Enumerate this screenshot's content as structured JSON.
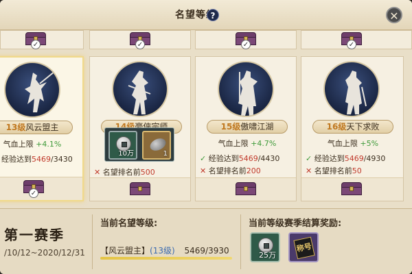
{
  "header": {
    "title": "名望等级",
    "help_icon": "?",
    "close_icon": "✕"
  },
  "cards": [
    {
      "level": "13级",
      "name": "风云盟主",
      "stat_label": "气血上限",
      "stat_bonus": "+4.1%",
      "exp_prefix": "经验达到",
      "exp_current": "5469",
      "exp_required": "/3430"
    },
    {
      "level": "14级",
      "name": "豪侠宗师",
      "stat_label": "",
      "stat_bonus": "",
      "exp_prefix": "",
      "exp_current": "",
      "exp_required": "",
      "rank_prefix": "名望排名前",
      "rank_value": "500"
    },
    {
      "level": "15级",
      "name": "傲啸江湖",
      "stat_label": "气血上限",
      "stat_bonus": "+4.7%",
      "exp_prefix": "经验达到",
      "exp_current": "5469",
      "exp_required": "/4430",
      "rank_prefix": "名望排名前",
      "rank_value": "200"
    },
    {
      "level": "16级",
      "name": "天下求败",
      "stat_label": "气血上限",
      "stat_bonus": "+5%",
      "exp_prefix": "经验达到",
      "exp_current": "5469",
      "exp_required": "/4930",
      "rank_prefix": "名望排名前",
      "rank_value": "50"
    }
  ],
  "popup": {
    "item1_amount": "10万",
    "item2_amount": "1"
  },
  "season": {
    "name": "第一赛季",
    "dates": "/10/12~2020/12/31"
  },
  "current": {
    "label": "当前名望等级:",
    "title_open": "【风云盟主】",
    "level": "(13级)",
    "exp": "5469/3930",
    "progress": 1.0
  },
  "rewards": {
    "label": "当前等级赛季结算奖励:",
    "coin_amount": "25万",
    "title_tag": "称号"
  },
  "colors": {
    "accent_gold": "#c07820",
    "bonus_green": "#3f9a3a",
    "rank_red": "#c0392b"
  }
}
